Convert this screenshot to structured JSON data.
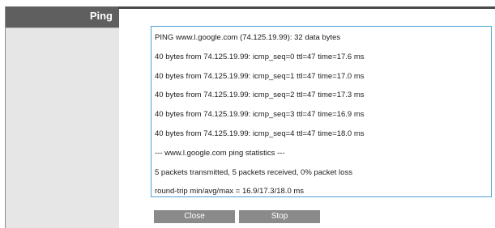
{
  "sidebar": {
    "title": "Ping"
  },
  "output": {
    "lines": [
      "PING www.l.google.com (74.125.19.99): 32 data bytes",
      "40 bytes from 74.125.19.99: icmp_seq=0 ttl=47 time=17.6 ms",
      "40 bytes from 74.125.19.99: icmp_seq=1 ttl=47 time=17.0 ms",
      "40 bytes from 74.125.19.99: icmp_seq=2 ttl=47 time=17.3 ms",
      "40 bytes from 74.125.19.99: icmp_seq=3 ttl=47 time=16.9 ms",
      "40 bytes from 74.125.19.99: icmp_seq=4 ttl=47 time=18.0 ms",
      "--- www.l.google.com ping statistics ---",
      "5 packets transmitted, 5 packets received, 0% packet loss",
      "round-trip min/avg/max = 16.9/17.3/18.0 ms"
    ]
  },
  "buttons": {
    "close_label": "Close",
    "stop_label": "Stop"
  },
  "colors": {
    "header": "#5f5f5f",
    "sidebar": "#e6e6e6",
    "box_border": "#4da3d6",
    "button": "#8a8a8a"
  }
}
